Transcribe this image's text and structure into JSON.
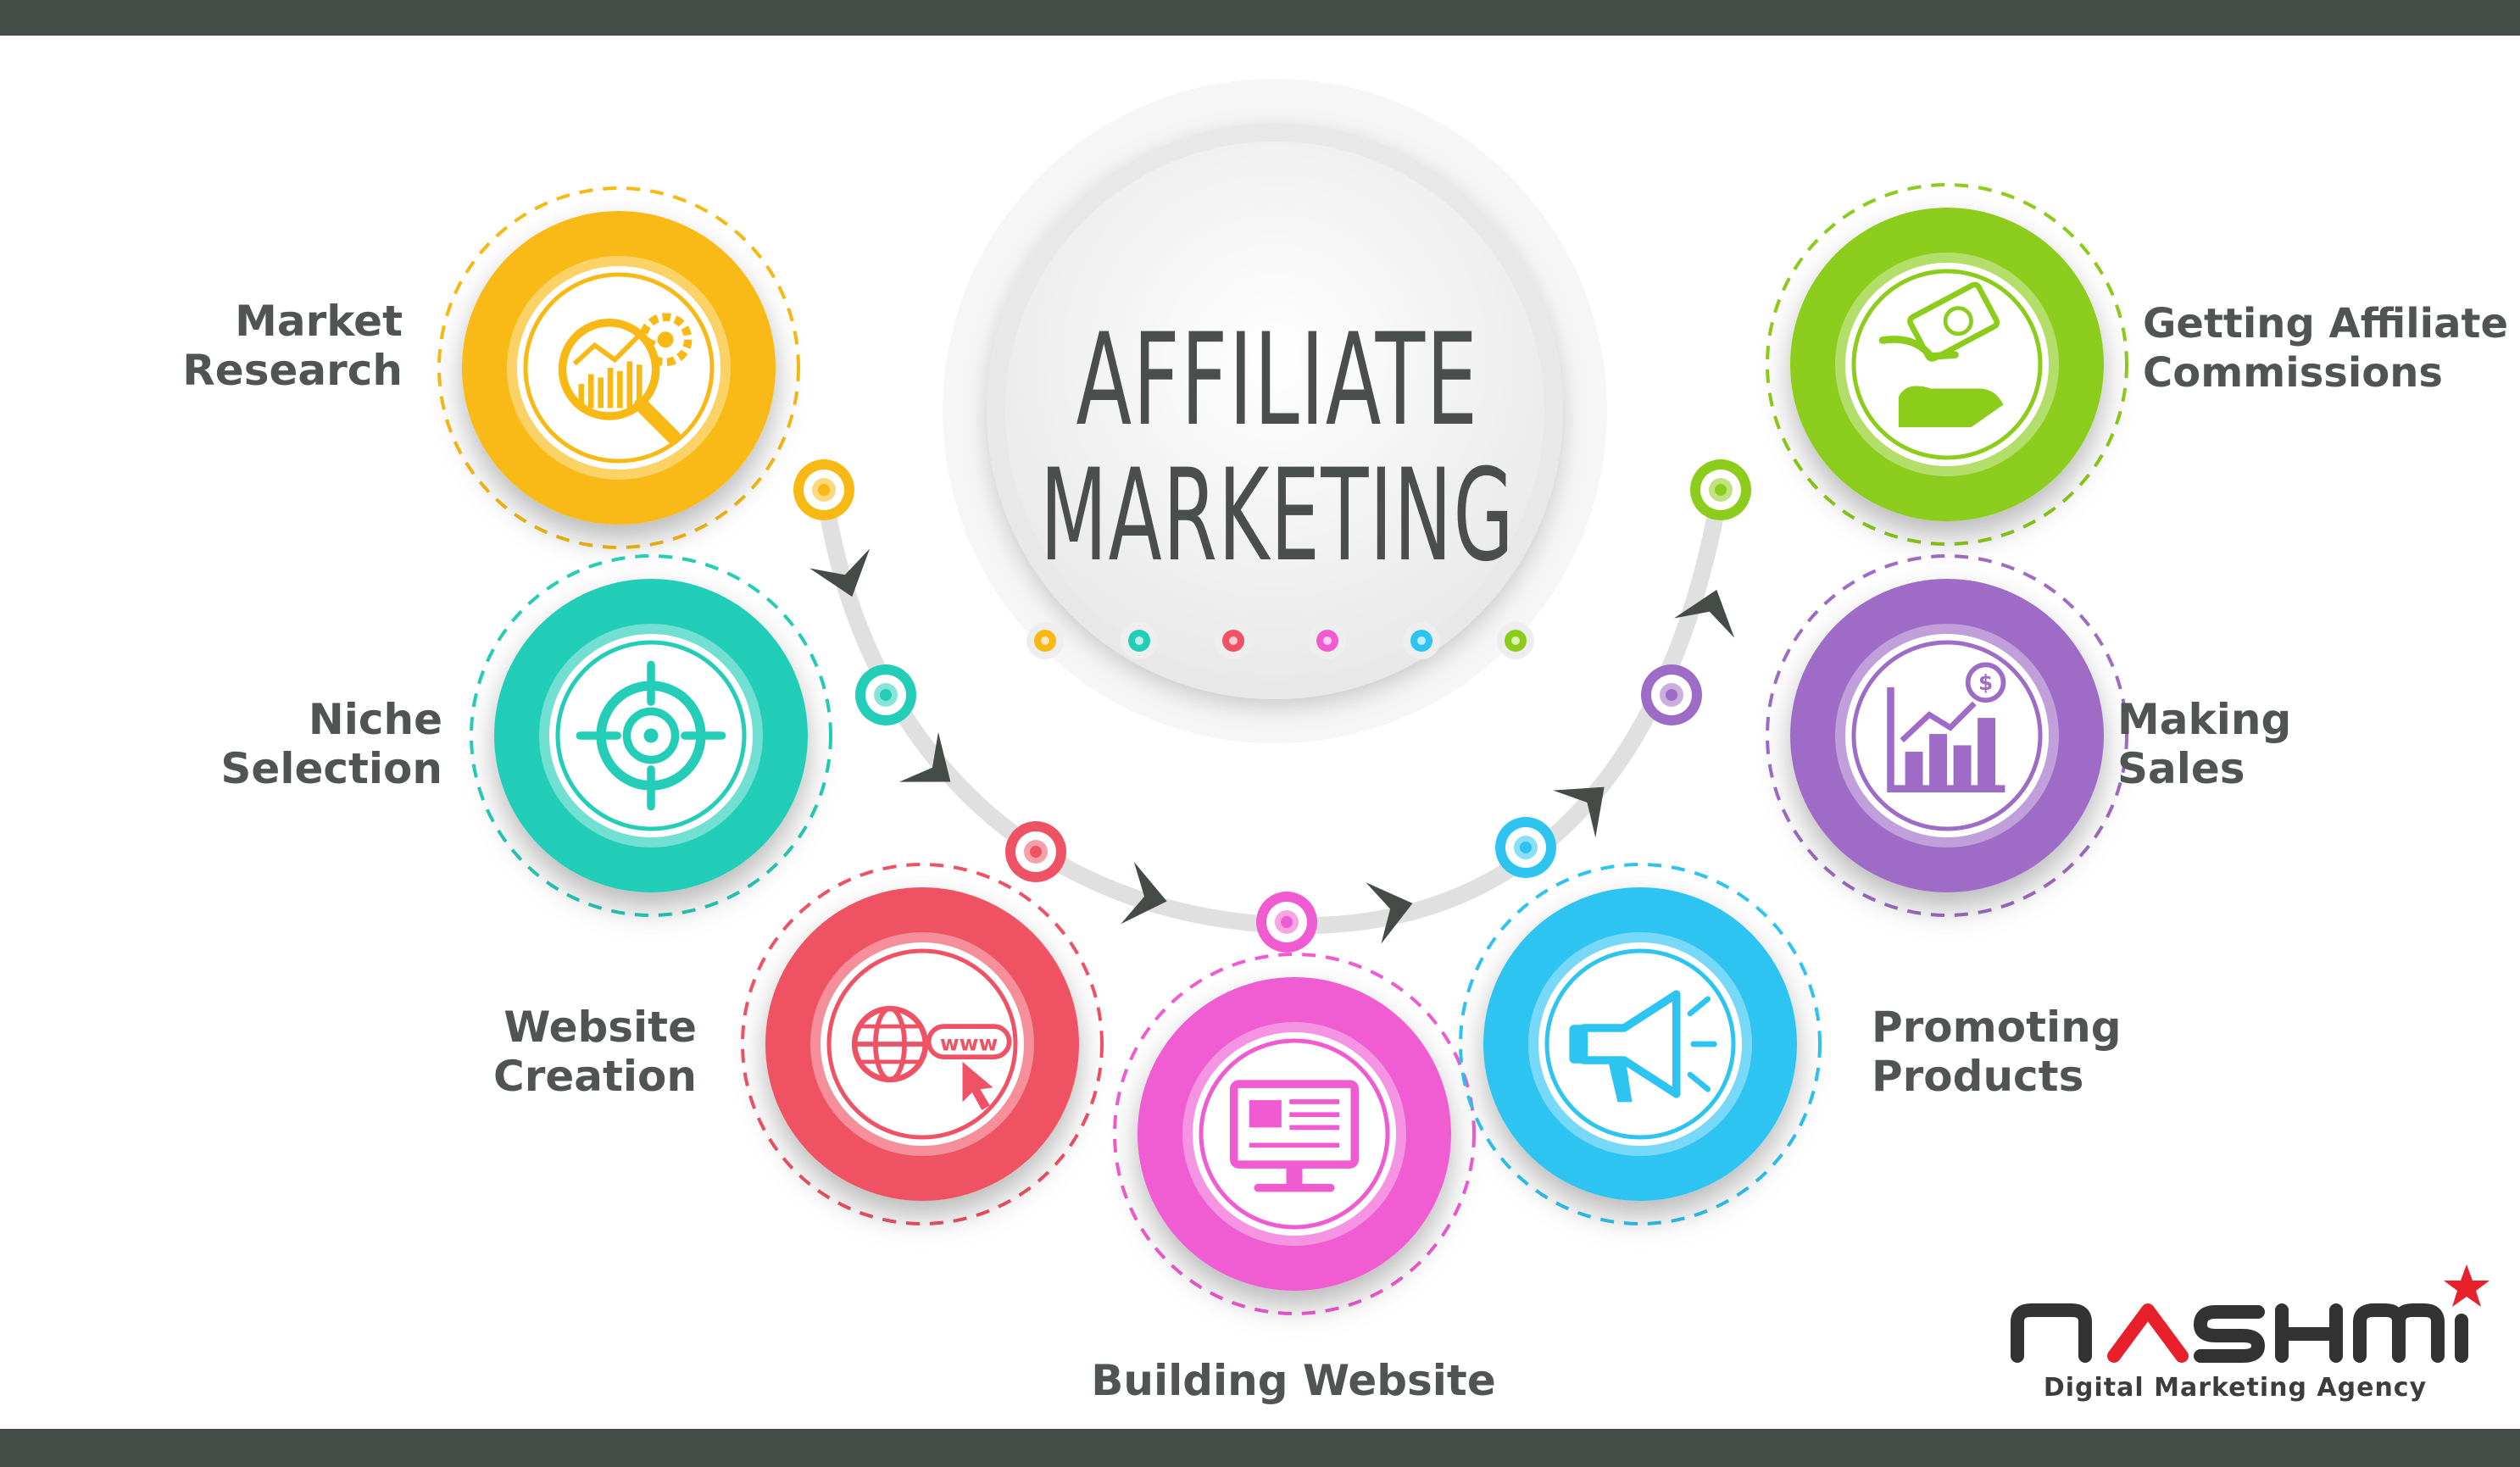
{
  "title": {
    "line1": "AFFILIATE",
    "line2": "MARKETING"
  },
  "steps": [
    {
      "id": "market-research",
      "lines": [
        "Market",
        "Research"
      ],
      "icon": "magnifier-gear-chart-icon",
      "color": "#f9b914"
    },
    {
      "id": "niche-selection",
      "lines": [
        "Niche",
        "Selection"
      ],
      "icon": "target-crosshair-icon",
      "color": "#24cdb8"
    },
    {
      "id": "website-creation",
      "lines": [
        "Website",
        "Creation"
      ],
      "icon": "globe-www-cursor-icon",
      "color": "#ef5264"
    },
    {
      "id": "building-website",
      "lines": [
        "Building Website"
      ],
      "icon": "monitor-icon",
      "color": "#f05bd2"
    },
    {
      "id": "promoting-products",
      "lines": [
        "Promoting",
        "Products"
      ],
      "icon": "megaphone-icon",
      "color": "#2ec4f2"
    },
    {
      "id": "making-sales",
      "lines": [
        "Making",
        "Sales"
      ],
      "icon": "bar-chart-dollar-icon",
      "color": "#9e6cc6"
    },
    {
      "id": "getting-affiliate-commissions",
      "lines": [
        "Getting Affiliate",
        "Commissions"
      ],
      "icon": "hand-money-icon",
      "color": "#8ccc1a"
    }
  ],
  "logo": {
    "wordmark": "nashmi",
    "tagline": "Digital Marketing Agency",
    "accent": "#e8202b"
  },
  "colors": {
    "bars": "#454c48",
    "path": "#e2e2e2",
    "arrows": "#454c48",
    "text": "#505452"
  }
}
